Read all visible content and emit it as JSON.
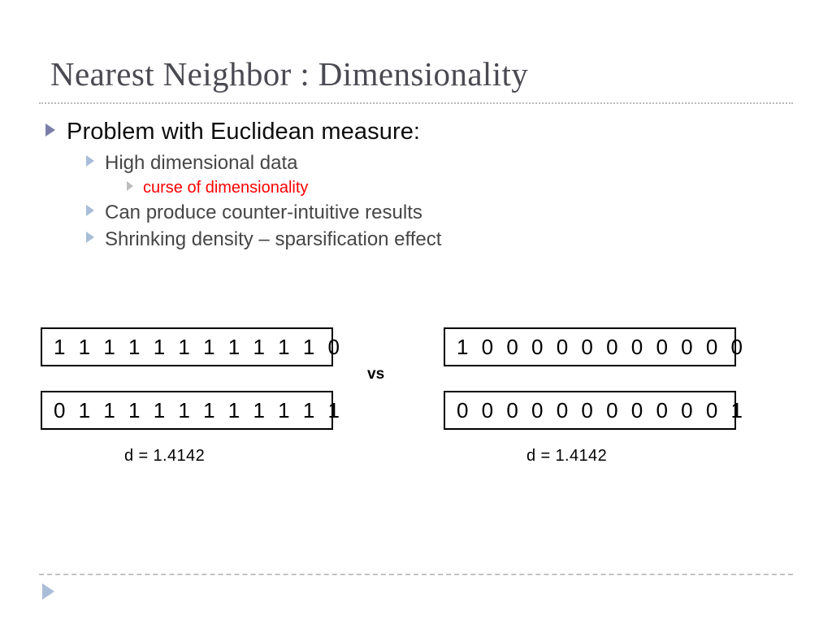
{
  "slide": {
    "title": "Nearest Neighbor : Dimensionality",
    "accent_bullet_level1": "#7b7fa8",
    "accent_bullet_level2": "#a9bdd8",
    "accent_bullet_level3": "#bdbdbd",
    "highlight_color": "#ff0000",
    "title_color": "#4a4a52"
  },
  "bullets": [
    {
      "level": 1,
      "text": "Problem with Euclidean measure:"
    },
    {
      "level": 2,
      "text": "High dimensional data"
    },
    {
      "level": 3,
      "text": "curse of dimensionality"
    },
    {
      "level": 2,
      "text": "Can produce counter-intuitive results"
    },
    {
      "level": 2,
      "text": "Shrinking density – sparsification effect"
    }
  ],
  "comparison": {
    "vs_label": "vs",
    "left": {
      "vector_top": "1 1 1 1 1 1 1 1 1 1 1 0",
      "vector_bottom": "0 1 1 1 1 1 1 1 1 1 1 1",
      "distance": "d = 1.4142"
    },
    "right": {
      "vector_top": "1 0 0 0 0 0 0 0 0 0 0 0",
      "vector_bottom": "0 0 0 0 0 0 0 0 0 0 0 1",
      "distance": "d = 1.4142"
    }
  }
}
